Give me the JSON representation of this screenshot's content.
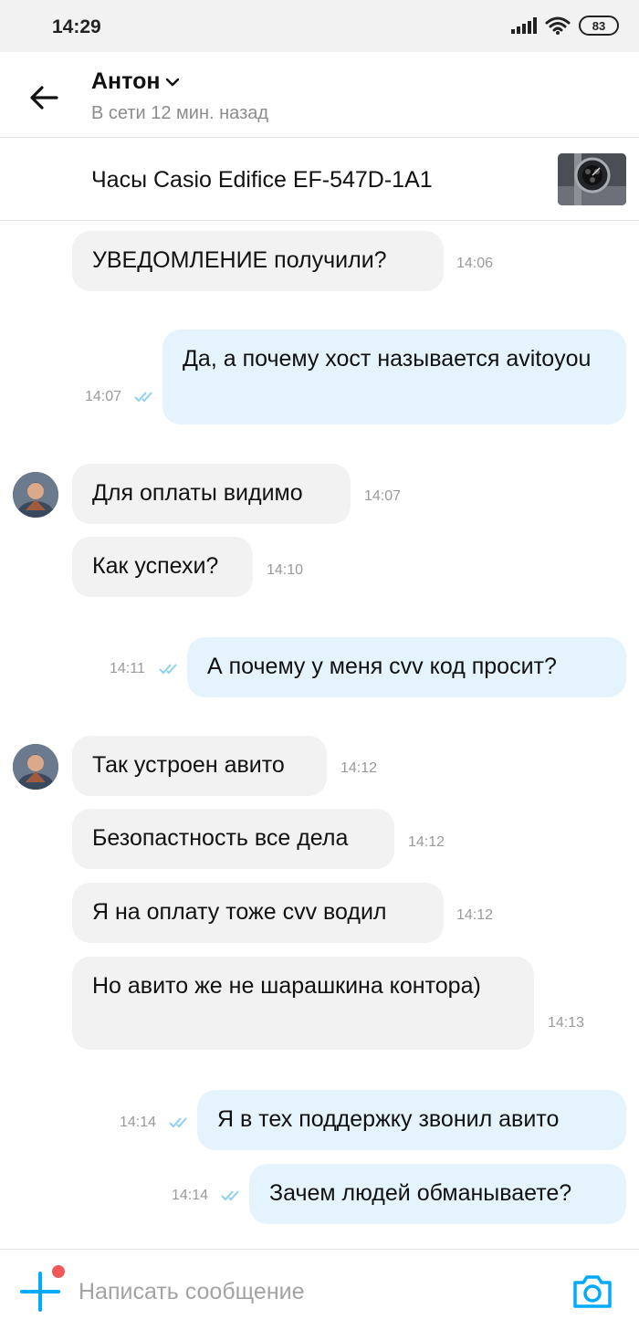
{
  "status_bar": {
    "time": "14:29",
    "battery": "83",
    "icons": [
      "signal-icon",
      "wifi-icon",
      "battery-icon"
    ]
  },
  "header": {
    "name": "Антон",
    "status": "В сети 12 мин. назад"
  },
  "listing": {
    "title": "Часы Casio Edifice EF-547D-1A1"
  },
  "messages": [
    {
      "dir": "in",
      "text": "УВЕДОМЛЕНИЕ получили?",
      "time": "14:06"
    },
    {
      "dir": "out",
      "text": "Да, а почему хост называется avitoyou",
      "time": "14:07"
    },
    {
      "dir": "in",
      "text": "Для оплаты видимо",
      "time": "14:07"
    },
    {
      "dir": "in",
      "text": "Как успехи?",
      "time": "14:10"
    },
    {
      "dir": "out",
      "text": "А почему у меня cvv код просит?",
      "time": "14:11"
    },
    {
      "dir": "in",
      "text": "Так устроен авито",
      "time": "14:12"
    },
    {
      "dir": "in",
      "text": "Безопастность все дела",
      "time": "14:12"
    },
    {
      "dir": "in",
      "text": "Я на оплату тоже cvv водил",
      "time": "14:12"
    },
    {
      "dir": "in",
      "text": "Но авито же не шарашкина контора)",
      "time": "14:13"
    },
    {
      "dir": "out",
      "text": "Я в тех поддержку звонил авито",
      "time": "14:14"
    },
    {
      "dir": "out",
      "text": "Зачем людей обманываете?",
      "time": "14:14"
    }
  ],
  "composer": {
    "placeholder": "Написать сообщение"
  },
  "colors": {
    "accent": "#00aaff",
    "incoming_bubble": "#f2f2f2",
    "outgoing_bubble": "#e5f4fc",
    "notification_dot": "#f05858",
    "read_ticks": "#8fd0f0"
  }
}
